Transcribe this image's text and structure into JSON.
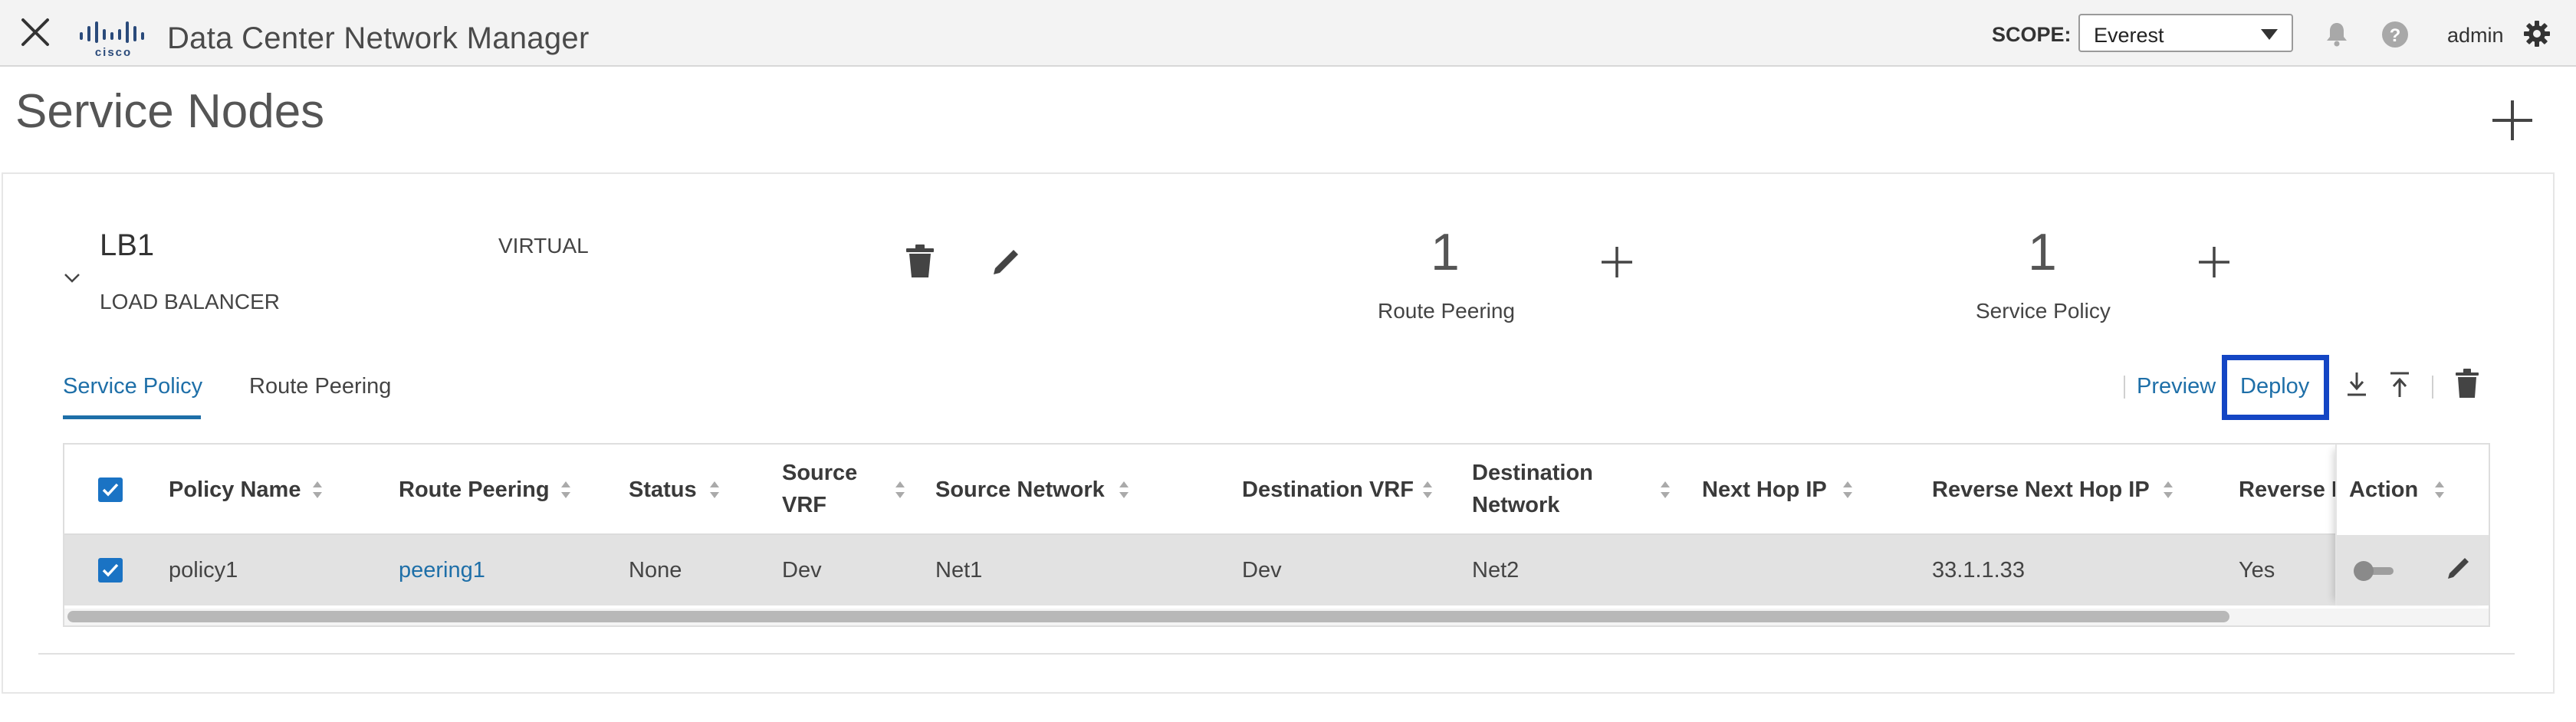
{
  "header": {
    "app_title": "Data Center Network Manager",
    "scope_label": "SCOPE:",
    "scope_value": "Everest",
    "user": "admin",
    "icons": [
      "close-icon",
      "cisco-logo",
      "bell-icon",
      "help-icon",
      "gear-icon"
    ]
  },
  "page": {
    "title": "Service Nodes"
  },
  "node": {
    "name": "LB1",
    "type": "LOAD BALANCER",
    "mode": "VIRTUAL",
    "route_peering": {
      "count": "1",
      "label": "Route Peering"
    },
    "service_policy": {
      "count": "1",
      "label": "Service Policy"
    }
  },
  "tabs": [
    {
      "label": "Service Policy",
      "active": true
    },
    {
      "label": "Route Peering",
      "active": false
    }
  ],
  "toolbar": {
    "preview_label": "Preview",
    "deploy_label": "Deploy"
  },
  "table": {
    "columns": [
      "Policy Name",
      "Route Peering",
      "Status",
      "Source VRF",
      "Source Network",
      "Destination VRF",
      "Destination Network",
      "Next Hop IP",
      "Reverse Next Hop IP",
      "Reverse E",
      "Action"
    ],
    "rows": [
      {
        "checked": true,
        "policy_name": "policy1",
        "route_peering": "peering1",
        "status": "None",
        "source_vrf": "Dev",
        "source_network": "Net1",
        "destination_vrf": "Dev",
        "destination_network": "Net2",
        "next_hop_ip": "",
        "reverse_next_hop_ip": "33.1.1.33",
        "reverse_e": "Yes"
      }
    ]
  },
  "colors": {
    "accent_blue": "#1e6fa8",
    "checkbox_blue": "#1a73c4",
    "highlight_box": "#1446c4",
    "header_bg": "#f3f3f3",
    "row_bg": "#e2e2e2"
  }
}
